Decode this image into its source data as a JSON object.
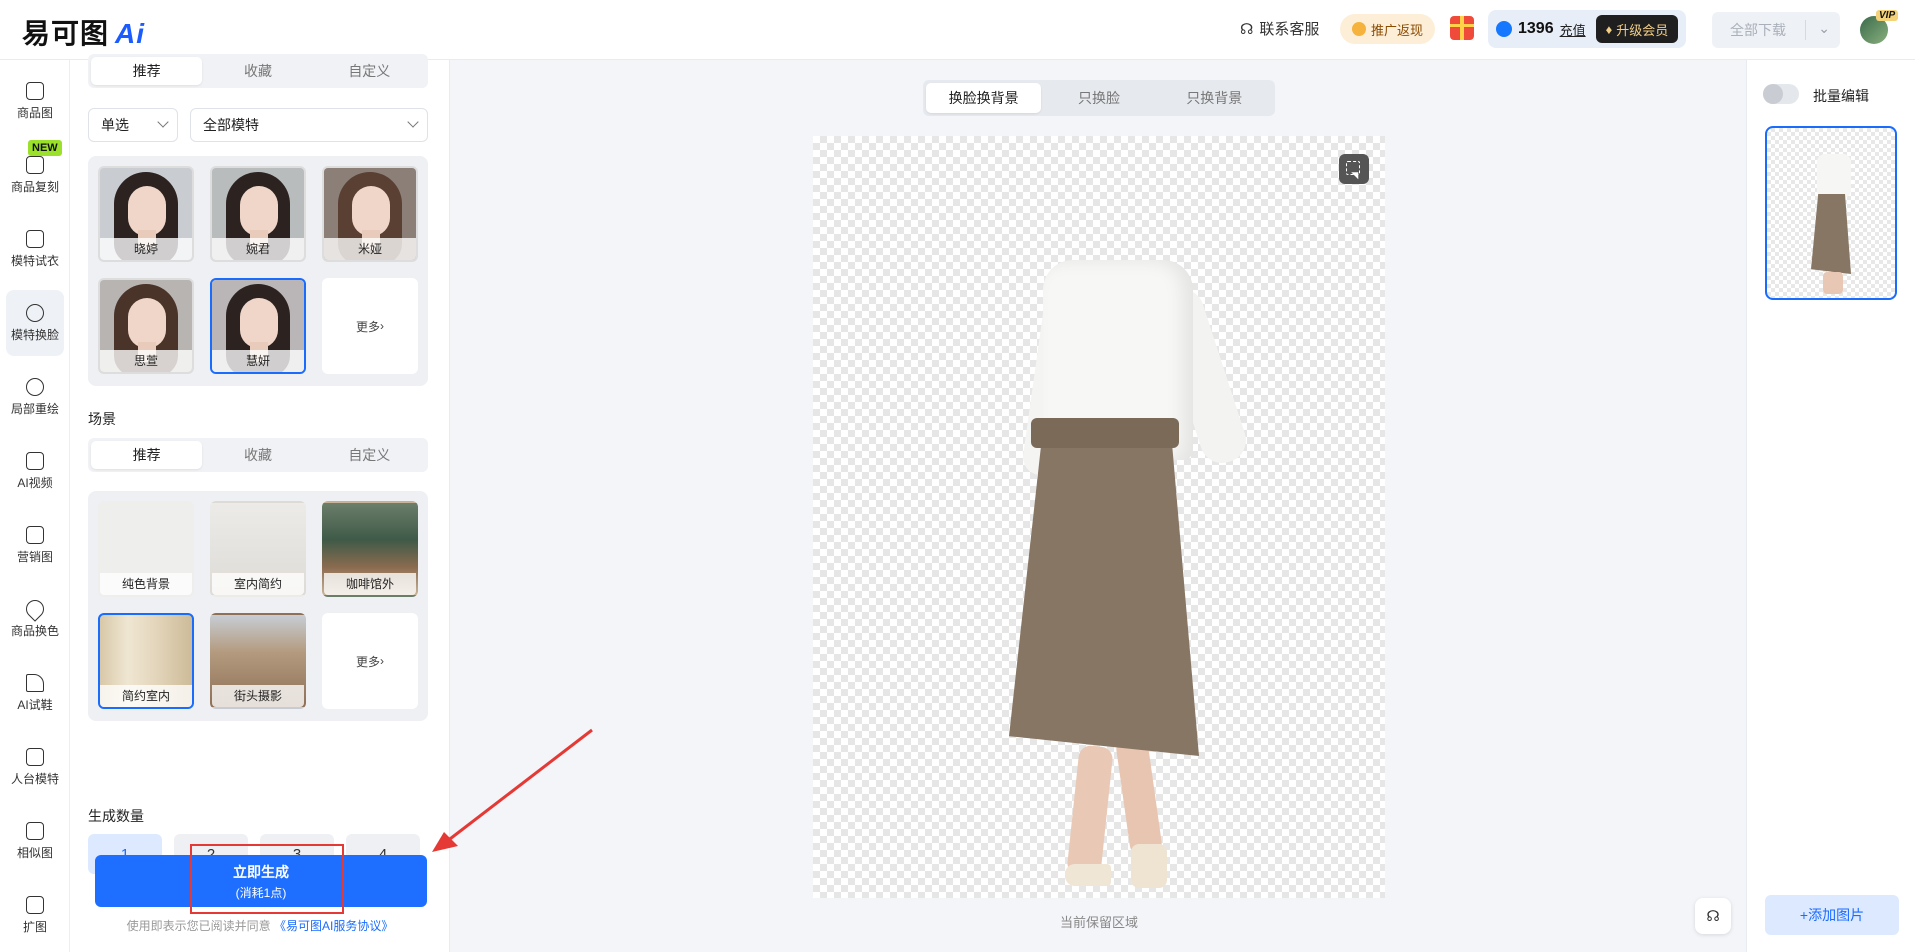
{
  "header": {
    "logo_text": "易可图",
    "logo_ai": "Ai",
    "service_label": "联系客服",
    "promo_label": "推广返现",
    "points": "1396",
    "recharge_label": "充值",
    "upgrade_label": "升级会员",
    "download_label": "全部下载",
    "vip_badge": "VIP"
  },
  "leftnav": {
    "new_badge": "NEW",
    "items": [
      {
        "label": "商品图",
        "icon": "product-image-icon"
      },
      {
        "label": "商品复刻",
        "icon": "product-replicate-icon"
      },
      {
        "label": "模特试衣",
        "icon": "tshirt-icon"
      },
      {
        "label": "模特换脸",
        "icon": "smiley-face-icon"
      },
      {
        "label": "局部重绘",
        "icon": "smiley-face-icon"
      },
      {
        "label": "AI视频",
        "icon": "video-icon"
      },
      {
        "label": "营销图",
        "icon": "document-icon"
      },
      {
        "label": "商品换色",
        "icon": "color-drop-icon"
      },
      {
        "label": "AI试鞋",
        "icon": "shoe-icon"
      },
      {
        "label": "人台模特",
        "icon": "mannequin-icon"
      },
      {
        "label": "相似图",
        "icon": "similar-image-icon"
      },
      {
        "label": "扩图",
        "icon": "expand-image-icon"
      }
    ]
  },
  "panel": {
    "model_tabs": [
      "推荐",
      "收藏",
      "自定义"
    ],
    "select_mode": "单选",
    "model_filter": "全部模特",
    "models": [
      "晓婷",
      "婉君",
      "米娅",
      "思萱",
      "慧妍"
    ],
    "more_label": "更多",
    "scene_section": "场景",
    "scene_tabs": [
      "推荐",
      "收藏",
      "自定义"
    ],
    "scenes": [
      "纯色背景",
      "室内简约",
      "咖啡馆外",
      "简约室内",
      "街头摄影"
    ],
    "count_section": "生成数量",
    "counts": [
      "1",
      "2",
      "3",
      "4"
    ],
    "generate_label": "立即生成",
    "generate_cost": "(消耗1点)",
    "agree_prefix": "使用即表示您已阅读并同意",
    "agree_link": "《易可图AI服务协议》"
  },
  "canvas": {
    "modes": [
      "换脸换背景",
      "只换脸",
      "只换背景"
    ],
    "caption": "当前保留区域"
  },
  "rpanel": {
    "batch_label": "批量编辑",
    "add_label": "+添加图片"
  }
}
